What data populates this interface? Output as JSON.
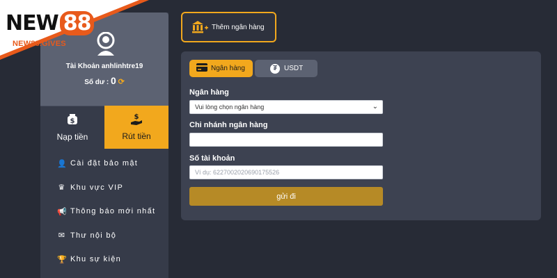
{
  "logo": {
    "brand_a": "NEW",
    "brand_b": "88",
    "domain": "NEW88.GIVES"
  },
  "profile": {
    "account_label": "Tài Khoản anhlinhtre19",
    "balance_label": "Số dư :",
    "balance_value": "0"
  },
  "tabs": {
    "deposit": {
      "icon": "dollar-bag-icon",
      "label": "Nạp tiền"
    },
    "withdraw": {
      "icon": "hand-dollar-icon",
      "label": "Rút tiền"
    }
  },
  "menu": [
    {
      "icon": "user-gear-icon",
      "glyph": "👤",
      "label": "Cài đặt bảo mật"
    },
    {
      "icon": "crown-icon",
      "glyph": "♛",
      "label": "Khu vực VIP"
    },
    {
      "icon": "megaphone-icon",
      "glyph": "📢",
      "label": "Thông báo mới nhất"
    },
    {
      "icon": "envelope-icon",
      "glyph": "✉",
      "label": "Thư nội bộ"
    },
    {
      "icon": "trophy-icon",
      "glyph": "🏆",
      "label": "Khu sự kiện"
    }
  ],
  "add_bank": {
    "label": "Thêm ngân hàng"
  },
  "panel": {
    "tab_bank": "Ngân hàng",
    "tab_usdt": "USDT",
    "bank_label": "Ngân hàng",
    "bank_select": "Vui lòng chọn ngân hàng",
    "branch_label": "Chi nhánh ngân hàng",
    "branch_value": "",
    "account_label": "Số tài khoản",
    "account_placeholder": "Ví dụ:  6227002020690175526",
    "submit": "gửi đi"
  },
  "colors": {
    "accent": "#f2a81d",
    "submit": "#b68a26",
    "bg": "#272b36",
    "panel": "#3d4251"
  }
}
